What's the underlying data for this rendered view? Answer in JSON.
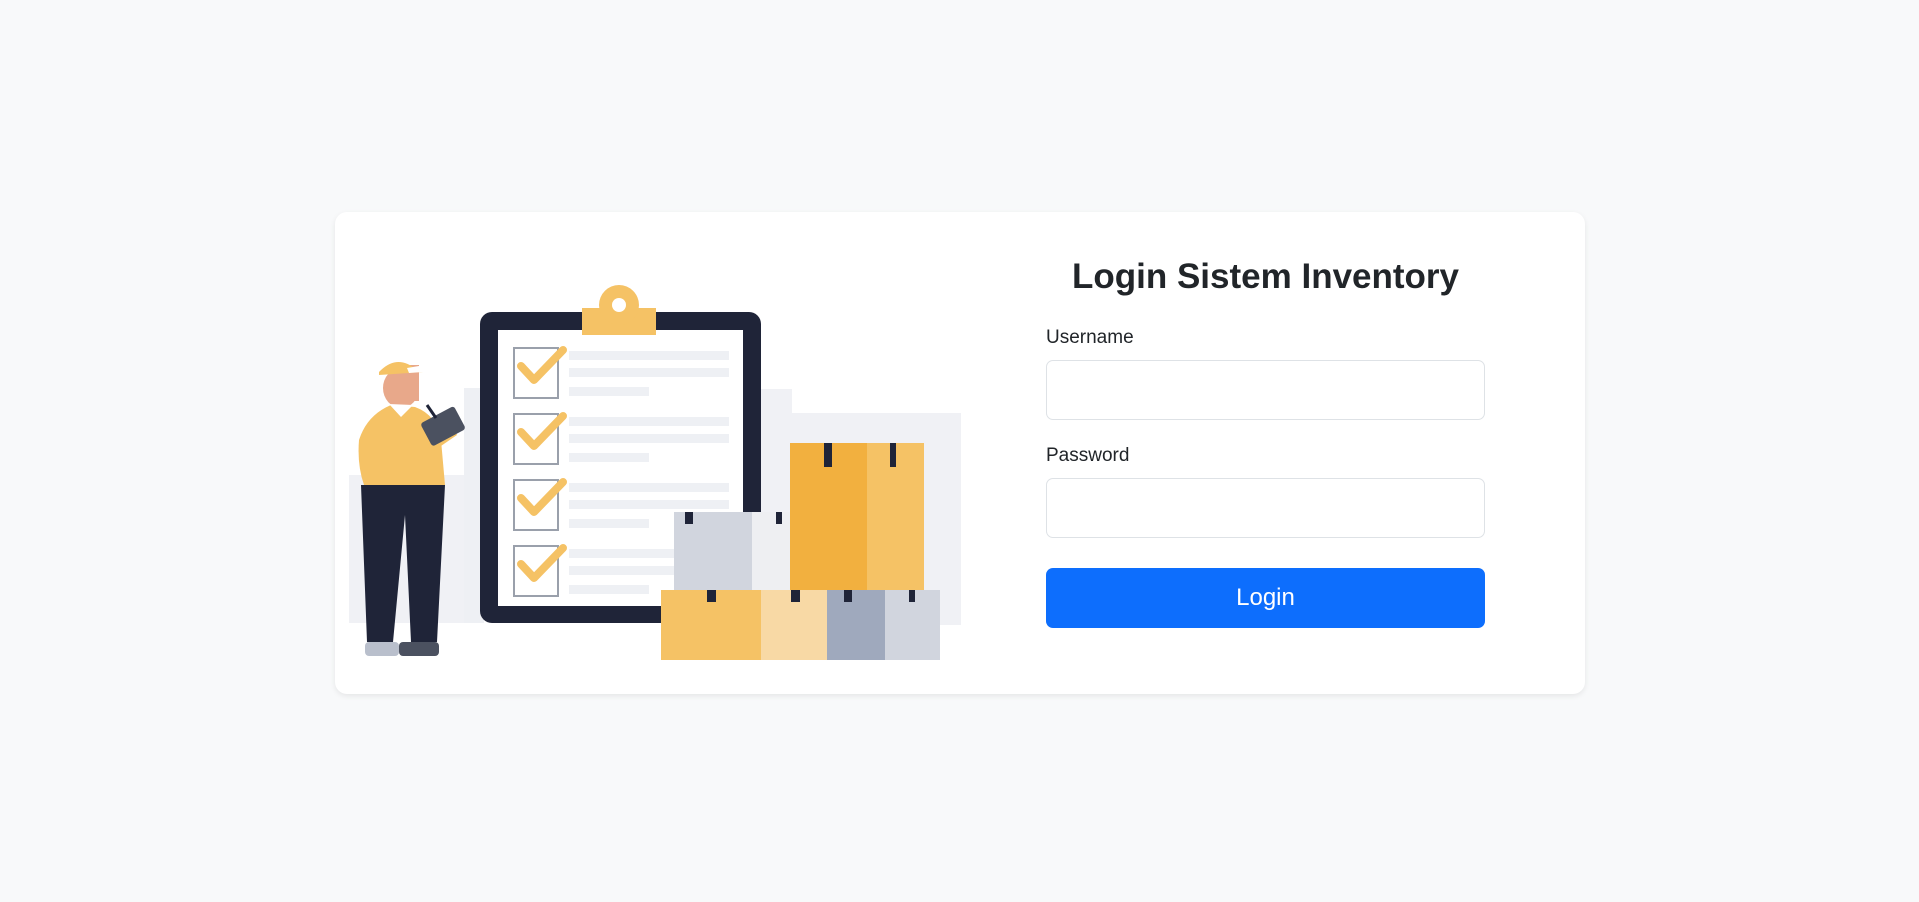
{
  "login": {
    "title": "Login Sistem Inventory",
    "username_label": "Username",
    "username_value": "",
    "password_label": "Password",
    "password_value": "",
    "submit_label": "Login"
  },
  "colors": {
    "page_background": "#f8f9fa",
    "card_background": "#ffffff",
    "primary": "#0d6efd",
    "illustration_yellow": "#f5c265",
    "illustration_navy": "#1f2438"
  },
  "illustration": {
    "icon": "inventory-checklist-illustration",
    "checklist_items_checked": 4
  }
}
